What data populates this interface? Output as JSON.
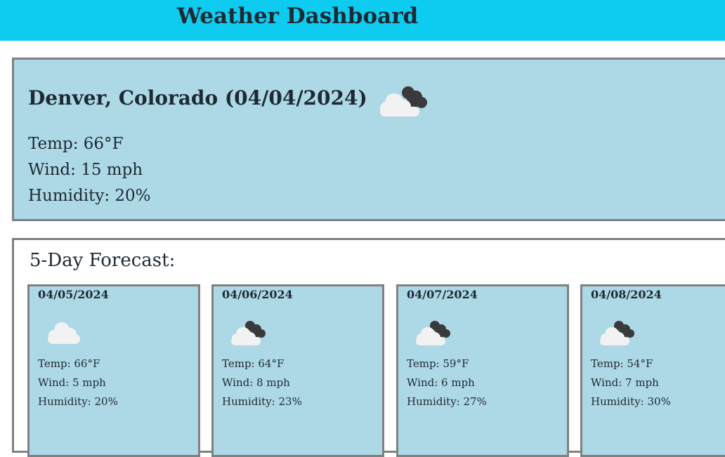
{
  "header": {
    "title": "Weather Dashboard"
  },
  "current": {
    "heading": "Denver, Colorado (04/04/2024)",
    "icon": "dark-clouds-icon",
    "temp": "Temp: 66°F",
    "wind": "Wind: 15 mph",
    "humidity": "Humidity: 20%"
  },
  "forecast": {
    "title": "5-Day Forecast:",
    "days": [
      {
        "date": "04/05/2024",
        "icon": "cloud-icon",
        "temp": "Temp: 66°F",
        "wind": "Wind: 5 mph",
        "humidity": "Humidity: 20%"
      },
      {
        "date": "04/06/2024",
        "icon": "dark-clouds-icon",
        "temp": "Temp: 64°F",
        "wind": "Wind: 8 mph",
        "humidity": "Humidity: 23%"
      },
      {
        "date": "04/07/2024",
        "icon": "dark-clouds-icon",
        "temp": "Temp: 59°F",
        "wind": "Wind: 6 mph",
        "humidity": "Humidity: 27%"
      },
      {
        "date": "04/08/2024",
        "icon": "dark-clouds-icon",
        "temp": "Temp: 54°F",
        "wind": "Wind: 7 mph",
        "humidity": "Humidity: 30%"
      }
    ]
  },
  "colors": {
    "header_bg": "#0ecbf0",
    "panel_bg": "#add8e6",
    "border": "#808080",
    "text": "#1e2a33"
  }
}
